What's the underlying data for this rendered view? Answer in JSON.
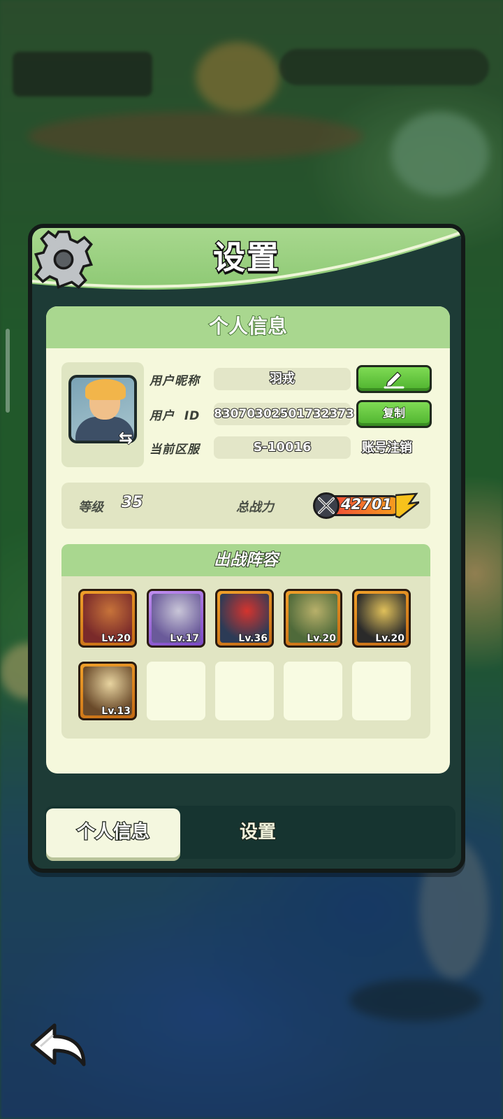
{
  "panel": {
    "title": "设置",
    "icon": "gear-icon"
  },
  "profile_section": {
    "header": "个人信息",
    "avatar_icon": "avatar-hero",
    "swap_icon": "⇆",
    "nickname_label": "用户昵称",
    "nickname_value": "羽戎",
    "edit_icon": "pencil-icon",
    "user_id_label": "用户  ID",
    "user_id_value": "83070302501732373",
    "copy_label": "复制",
    "server_label": "当前区服",
    "server_value": "S-10016",
    "deregister_label": "账号注销"
  },
  "stats": {
    "level_label": "等级",
    "level_value": "35",
    "power_label": "总战力",
    "power_value": "42701",
    "power_icon": "crossed-swords-icon"
  },
  "lineup": {
    "header": "出战阵容",
    "heroes": [
      {
        "level": "Lv.20",
        "rarity": "orange",
        "colors": [
          "#7a2a2a",
          "#c7733a"
        ]
      },
      {
        "level": "Lv.17",
        "rarity": "purple",
        "colors": [
          "#6a5a9a",
          "#c9c6d8"
        ]
      },
      {
        "level": "Lv.36",
        "rarity": "orange",
        "colors": [
          "#2c3b56",
          "#d4342e"
        ]
      },
      {
        "level": "Lv.20",
        "rarity": "orange",
        "colors": [
          "#4f6a3a",
          "#b8b06a"
        ]
      },
      {
        "level": "Lv.20",
        "rarity": "orange",
        "colors": [
          "#2a2a2a",
          "#e0c05a"
        ]
      },
      {
        "level": "Lv.13",
        "rarity": "orange",
        "colors": [
          "#6a4a2a",
          "#e8d4a0"
        ]
      }
    ],
    "empty_slots": 4
  },
  "tabs": [
    {
      "label": "个人信息",
      "active": true
    },
    {
      "label": "设置",
      "active": false
    }
  ],
  "navigation": {
    "back_icon": "back-arrow-icon"
  },
  "colors": {
    "header_green": "#a9d78f",
    "button_green": "#4eb22e",
    "panel_dark": "#1d3b36",
    "card_bg": "#f5f8dc"
  }
}
